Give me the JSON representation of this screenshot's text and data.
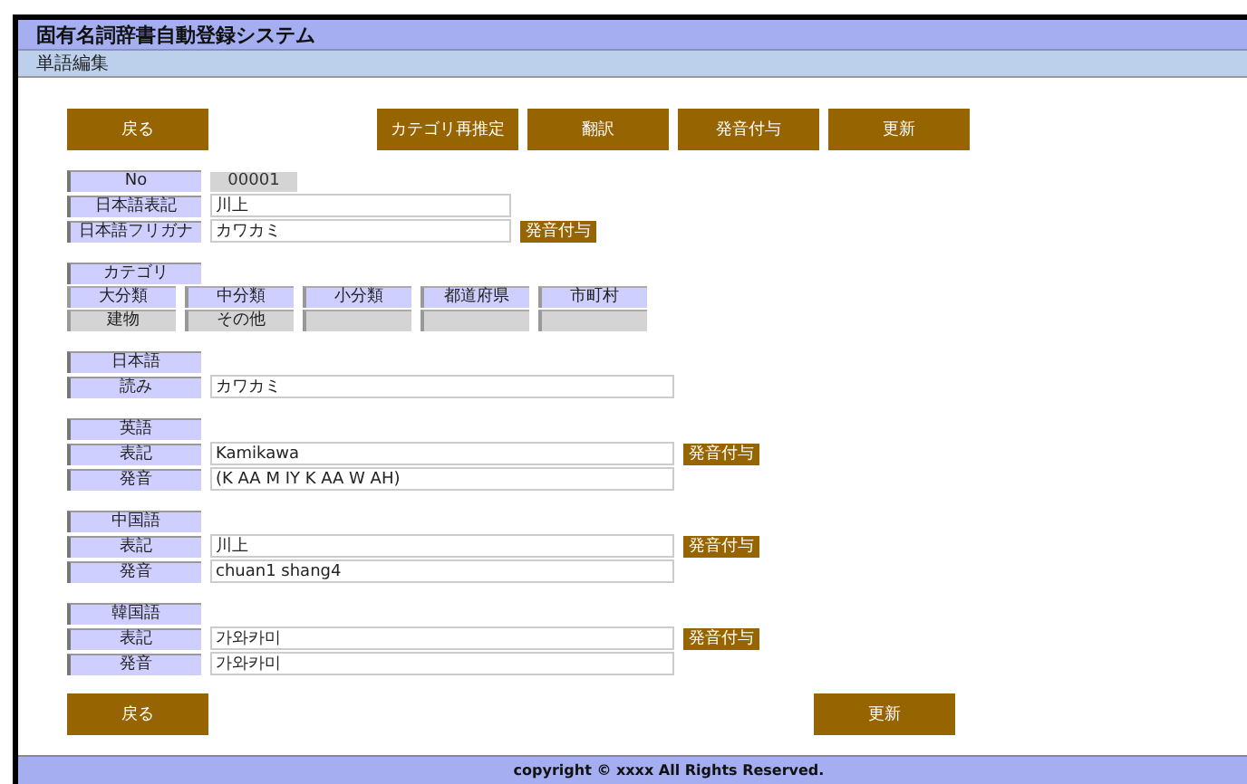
{
  "title": "固有名詞辞書自動登録システム",
  "subtitle": "単語編集",
  "top_buttons": {
    "left": [
      "戻る"
    ],
    "right": [
      "カテゴリ再推定",
      "翻訳",
      "発音付与",
      "更新"
    ]
  },
  "blocks": [
    {
      "kind": "record",
      "rows": [
        {
          "kind": "display",
          "label": "No",
          "value": "00001"
        },
        {
          "kind": "input",
          "label": "日本語表記",
          "value": "川上"
        },
        {
          "kind": "input",
          "label": "日本語フリガナ",
          "value": "カワカミ",
          "button": "発音付与"
        }
      ]
    },
    {
      "kind": "category",
      "heading": "カテゴリ",
      "columns": [
        {
          "header": "大分類",
          "value": "建物"
        },
        {
          "header": "中分類",
          "value": "その他"
        },
        {
          "header": "小分類"
        },
        {
          "header": "都道府県"
        },
        {
          "header": "市町村"
        }
      ]
    },
    {
      "kind": "language",
      "heading": "日本語",
      "rows": [
        {
          "kind": "input",
          "label": "読み",
          "value": "カワカミ"
        }
      ]
    },
    {
      "kind": "language",
      "heading": "英語",
      "rows": [
        {
          "kind": "input",
          "label": "表記",
          "value": "Kamikawa",
          "button": "発音付与"
        },
        {
          "kind": "input",
          "label": "発音",
          "value": "(K AA M IY K AA W AH)"
        }
      ]
    },
    {
      "kind": "language",
      "heading": "中国語",
      "rows": [
        {
          "kind": "input",
          "label": "表記",
          "value": "川上",
          "button": "発音付与"
        },
        {
          "kind": "input",
          "label": "発音",
          "value": "chuan1 shang4"
        }
      ]
    },
    {
      "kind": "language",
      "heading": "韓国語",
      "rows": [
        {
          "kind": "input",
          "label": "表記",
          "value": "가와카미",
          "button": "発音付与"
        },
        {
          "kind": "input",
          "label": "発音",
          "value": "가와카미"
        }
      ]
    }
  ],
  "bottom_buttons": {
    "left": [
      "戻る"
    ],
    "right": [
      "更新"
    ]
  },
  "footer": "copyright © xxxx All Rights Reserved."
}
